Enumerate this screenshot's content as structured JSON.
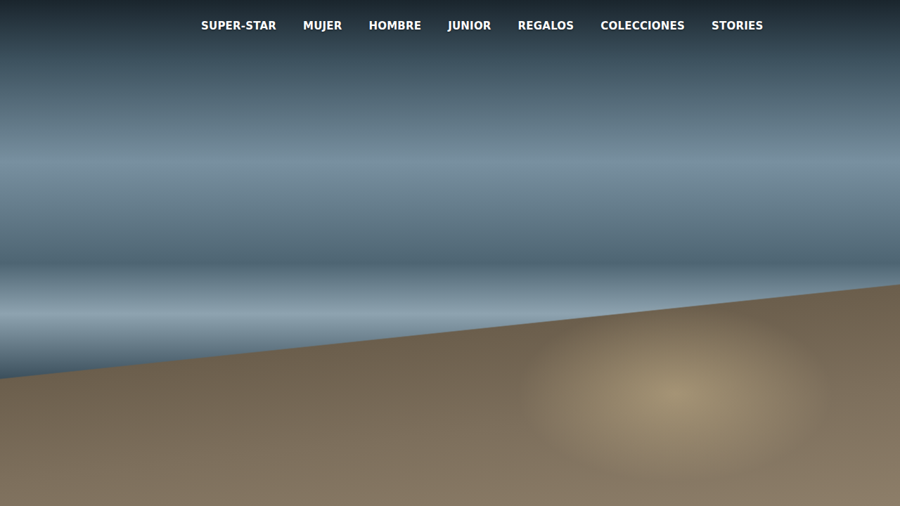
{
  "nav": {
    "items": [
      {
        "label": "SUPER-STAR"
      },
      {
        "label": "MUJER"
      },
      {
        "label": "HOMBRE"
      },
      {
        "label": "JUNIOR"
      },
      {
        "label": "REGALOS"
      },
      {
        "label": "COLECCIONES"
      },
      {
        "label": "STORIES"
      }
    ]
  },
  "hero": {
    "kind": "photo"
  }
}
